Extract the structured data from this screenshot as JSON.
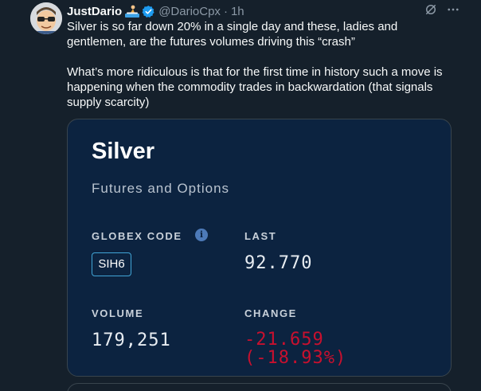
{
  "author": {
    "display_name": "JustDario",
    "handle": "@DarioCpx",
    "separator": "·",
    "time": "1h"
  },
  "icons": {
    "avatar": "cartoon-avatar-with-glasses",
    "emoji": "person-surfing-emoji",
    "verified": "verified-badge-icon",
    "grok": "grok-icon",
    "more": "more-icon"
  },
  "tweet": {
    "paragraphs": [
      "Silver is so far down 20% in a single day and these, ladies and gentlemen, are the futures volumes driving this “crash”",
      "What’s more ridiculous is that for the first time in history such a move is happening when the commodity trades in backwardation (that signals supply scarcity)"
    ]
  },
  "card": {
    "title": "Silver",
    "subtitle": "Futures and Options",
    "globex_label": "GLOBEX CODE",
    "info_icon": "i",
    "globex_code": "SIH6",
    "last_label": "LAST",
    "last_value": "92.770",
    "volume_label": "VOLUME",
    "volume_value": "179,251",
    "change_label": "CHANGE",
    "change_value": "-21.659",
    "change_pct": "(-18.93%)"
  },
  "colors": {
    "background": "#15202b",
    "card_background": "#0c2340",
    "accent": "#1d9bf0",
    "negative": "#c8102e",
    "secondary_text": "#8b98a5"
  }
}
